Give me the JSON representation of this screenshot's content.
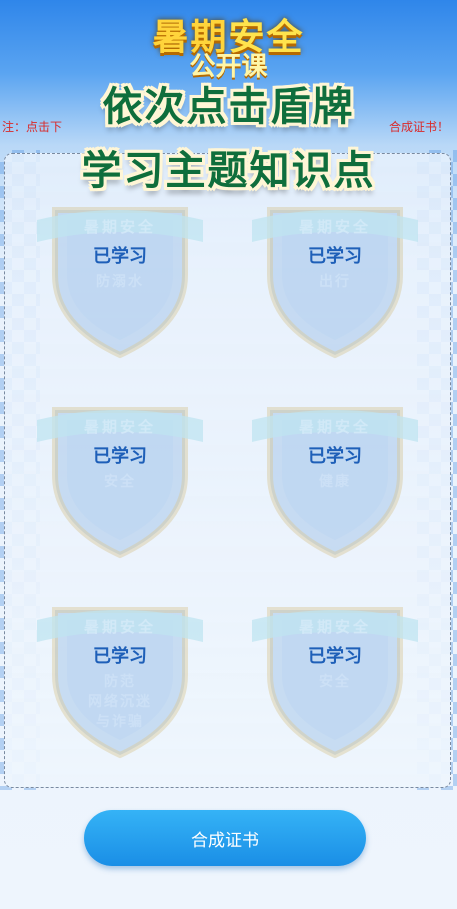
{
  "header": {
    "title_part1": "暑期",
    "title_part2": "安全",
    "title_part3": "公开课"
  },
  "note": {
    "left": "注：点击下",
    "right": "合成证书！"
  },
  "overlay": {
    "line1": "依次点击盾牌",
    "line2": "学习主题知识点"
  },
  "shields": [
    {
      "ribbon": "暑期安全",
      "status": "已学习",
      "topic": "防溺水"
    },
    {
      "ribbon": "暑期安全",
      "status": "已学习",
      "topic": "出行"
    },
    {
      "ribbon": "暑期安全",
      "status": "已学习",
      "topic": "安全"
    },
    {
      "ribbon": "暑期安全",
      "status": "已学习",
      "topic": "健康"
    },
    {
      "ribbon": "暑期安全",
      "status": "已学习",
      "topic": "防范\n网络沉迷\n与诈骗"
    },
    {
      "ribbon": "暑期安全",
      "status": "已学习",
      "topic": "安全"
    }
  ],
  "button": {
    "label": "合成证书"
  },
  "icons": {
    "shield": "shield-icon"
  },
  "colors": {
    "accent": "#1a8ee6",
    "learned_text": "#1e5fb8",
    "overlay_text": "#0f6e3c",
    "note_text": "#d92a2a"
  }
}
